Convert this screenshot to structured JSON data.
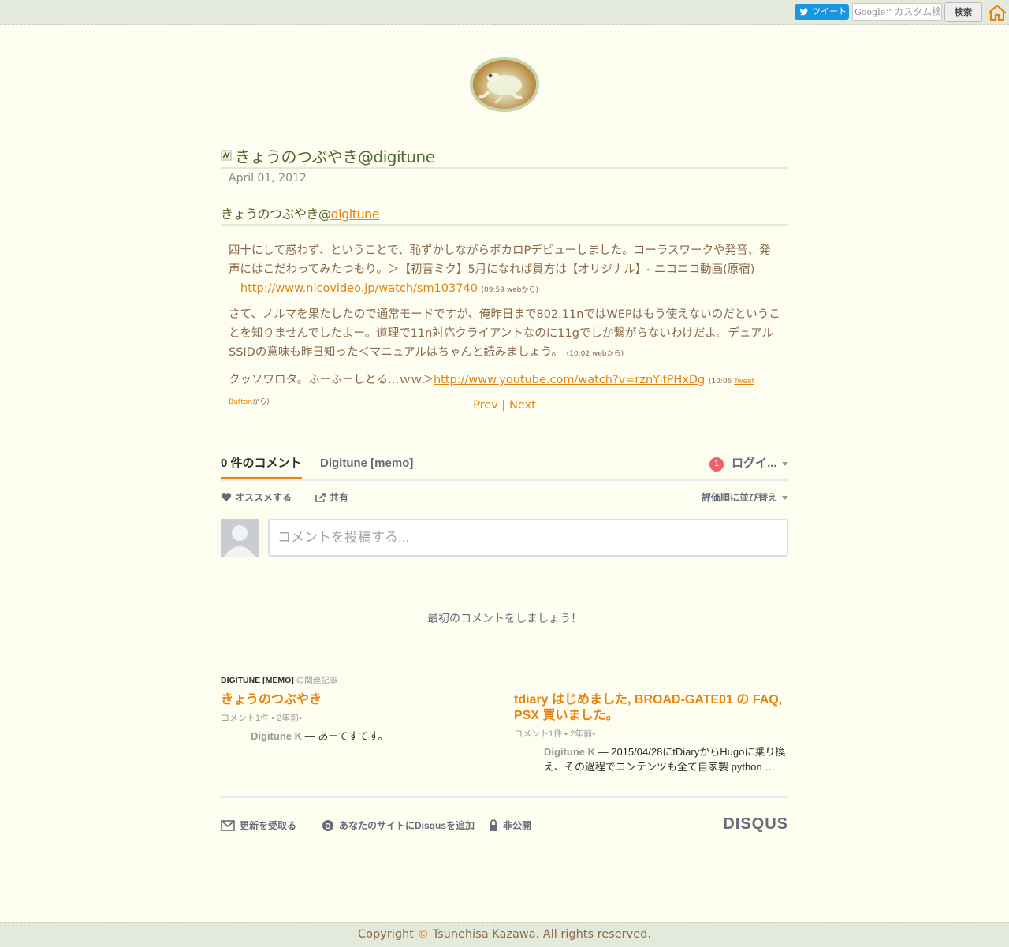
{
  "topbar": {
    "tweet_label": "ツイート",
    "search_placeholder": "カスタム検索",
    "search_brand": "Google™",
    "search_button": "検索"
  },
  "post": {
    "title": "きょうのつぶやき@digitune",
    "date": "April 01, 2012",
    "subtitle_prefix": "きょうのつぶやき@",
    "subtitle_link": "digitune",
    "tweets": [
      {
        "text": "四十にして惑わず、ということで、恥ずかしながらボカロPデビューしました。コーラスワークや発音、発声にはこだわってみたつもり。＞【初音ミク】5月になれば貴方は【オリジナル】- ニコニコ動画(原宿)",
        "link": "http://www.nicovideo.jp/watch/sm103740",
        "meta": "(09:59 webから)"
      },
      {
        "text": "さて、ノルマを果たしたので通常モードですが、俺昨日まで802.11nではWEPはもう使えないのだということを知りませんでしたよー。道理で11n対応クライアントなのに11gでしか繋がらないわけだよ。デュアルSSIDの意味も昨日知った＜マニュアルはちゃんと読みましょう。",
        "meta": "(10:02 webから)"
      },
      {
        "text": "クッソワロタ。ふーふーしとる…ｗｗ＞",
        "link": "http://www.youtube.com/watch?v=rznYifPHxDg",
        "meta_prefix": "(10:06 ",
        "meta_link": "Tweet Button",
        "meta_suffix": "から)"
      }
    ],
    "prev": "Prev",
    "separator": "|",
    "next": "Next"
  },
  "disqus": {
    "comment_count_tab": "0 件のコメント",
    "site_tab": "Digitune [memo]",
    "notification_count": "1",
    "login": "ログイ...",
    "recommend": "オススメする",
    "share": "共有",
    "sort": "評価順に並び替え",
    "comment_placeholder": "コメントを投稿する...",
    "empty_message": "最初のコメントをしましょう！",
    "related_heading_site": "DIGITUNE [MEMO]",
    "related_heading_suffix": "の関連記事",
    "related": [
      {
        "title": "きょうのつぶやき",
        "meta": "コメント1件 • 2年前•",
        "author": "Digitune K",
        "snippet": "— あーてすてす。"
      },
      {
        "title": "tdiary はじめました, BROAD-GATE01 の FAQ, PSX 買いました。",
        "meta": "コメント1件 • 2年前•",
        "author": "Digitune K",
        "snippet": "— 2015/04/28にtDiaryからHugoに乗り換え、その過程でコンテンツも全て自家製 python …"
      }
    ],
    "footer_subscribe": "更新を受取る",
    "footer_add": "あなたのサイトにDisqusを追加",
    "footer_privacy": "非公開",
    "brand": "DISQUS"
  },
  "footer": {
    "copyright_prefix": "Copyright ",
    "copyright_symbol": "©",
    "copyright_text": " Tsunehisa Kazawa. All rights reserved."
  },
  "colors": {
    "accent": "#e8820e",
    "title_green": "#4e6b2a",
    "text_brown": "#8a6a4a",
    "bar_bg": "#e4eadb",
    "page_bg": "#fdfdf0"
  }
}
